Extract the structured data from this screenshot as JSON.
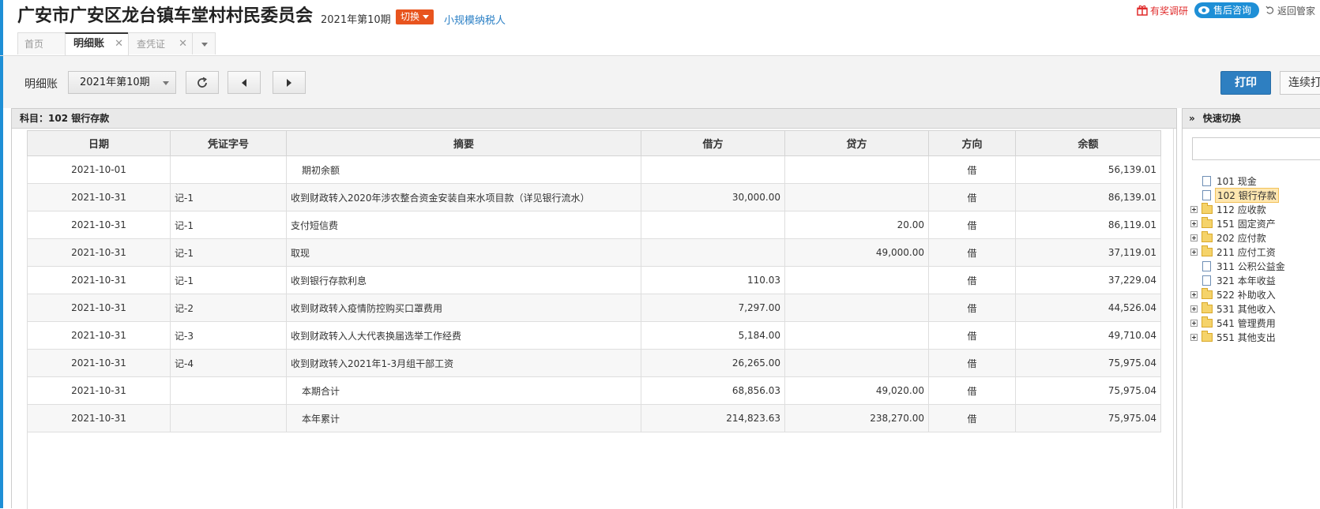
{
  "header": {
    "company": "广安市广安区龙台镇车堂村村民委员会",
    "period": "2021年第10期",
    "switch_label": "切换",
    "taxpayer_type": "小规模纳税人",
    "survey_label": "有奖调研",
    "service_label": "售后咨询",
    "back_label": "返回管家"
  },
  "tabs": [
    {
      "label": "首页"
    },
    {
      "label": "明细账"
    },
    {
      "label": "查凭证"
    }
  ],
  "toolbar": {
    "label": "明细账",
    "period_value": "2021年第10期",
    "print_label": "打印",
    "continuous_print_label": "连续打"
  },
  "ledger": {
    "subject": "科目：102 银行存款",
    "columns": [
      "日期",
      "凭证字号",
      "摘要",
      "借方",
      "贷方",
      "方向",
      "余额"
    ],
    "rows": [
      {
        "date": "2021-10-01",
        "voucher": "",
        "summary": "期初余额",
        "debit": "",
        "credit": "",
        "dir": "借",
        "balance": "56,139.01"
      },
      {
        "date": "2021-10-31",
        "voucher": "记-1",
        "summary": "收到财政转入2020年涉农整合资金安装自来水项目款（详见银行流水）",
        "debit": "30,000.00",
        "credit": "",
        "dir": "借",
        "balance": "86,139.01"
      },
      {
        "date": "2021-10-31",
        "voucher": "记-1",
        "summary": "支付短信费",
        "debit": "",
        "credit": "20.00",
        "dir": "借",
        "balance": "86,119.01"
      },
      {
        "date": "2021-10-31",
        "voucher": "记-1",
        "summary": "取现",
        "debit": "",
        "credit": "49,000.00",
        "dir": "借",
        "balance": "37,119.01"
      },
      {
        "date": "2021-10-31",
        "voucher": "记-1",
        "summary": "收到银行存款利息",
        "debit": "110.03",
        "credit": "",
        "dir": "借",
        "balance": "37,229.04"
      },
      {
        "date": "2021-10-31",
        "voucher": "记-2",
        "summary": "收到财政转入疫情防控购买口罩费用",
        "debit": "7,297.00",
        "credit": "",
        "dir": "借",
        "balance": "44,526.04"
      },
      {
        "date": "2021-10-31",
        "voucher": "记-3",
        "summary": "收到财政转入人大代表换届选举工作经费",
        "debit": "5,184.00",
        "credit": "",
        "dir": "借",
        "balance": "49,710.04"
      },
      {
        "date": "2021-10-31",
        "voucher": "记-4",
        "summary": "收到财政转入2021年1-3月组干部工资",
        "debit": "26,265.00",
        "credit": "",
        "dir": "借",
        "balance": "75,975.04"
      },
      {
        "date": "2021-10-31",
        "voucher": "",
        "summary": "本期合计",
        "debit": "68,856.03",
        "credit": "49,020.00",
        "dir": "借",
        "balance": "75,975.04"
      },
      {
        "date": "2021-10-31",
        "voucher": "",
        "summary": "本年累计",
        "debit": "214,823.63",
        "credit": "238,270.00",
        "dir": "借",
        "balance": "75,975.04"
      }
    ]
  },
  "quick_switch": {
    "title": "快速切换",
    "search_value": "",
    "items": [
      {
        "label": "101 现金",
        "type": "doc",
        "expandable": false,
        "selected": false
      },
      {
        "label": "102 银行存款",
        "type": "doc",
        "expandable": false,
        "selected": true
      },
      {
        "label": "112 应收款",
        "type": "folder",
        "expandable": true,
        "selected": false
      },
      {
        "label": "151 固定资产",
        "type": "folder",
        "expandable": true,
        "selected": false
      },
      {
        "label": "202 应付款",
        "type": "folder",
        "expandable": true,
        "selected": false
      },
      {
        "label": "211 应付工资",
        "type": "folder",
        "expandable": true,
        "selected": false
      },
      {
        "label": "311 公积公益金",
        "type": "doc",
        "expandable": false,
        "selected": false
      },
      {
        "label": "321 本年收益",
        "type": "doc",
        "expandable": false,
        "selected": false
      },
      {
        "label": "522 补助收入",
        "type": "folder",
        "expandable": true,
        "selected": false
      },
      {
        "label": "531 其他收入",
        "type": "folder",
        "expandable": true,
        "selected": false
      },
      {
        "label": "541 管理费用",
        "type": "folder",
        "expandable": true,
        "selected": false
      },
      {
        "label": "551 其他支出",
        "type": "folder",
        "expandable": true,
        "selected": false
      }
    ]
  },
  "colors": {
    "accent": "#1e8fd6",
    "switch": "#e8541e",
    "print": "#2e7fc1",
    "survey": "#e02c2c"
  }
}
